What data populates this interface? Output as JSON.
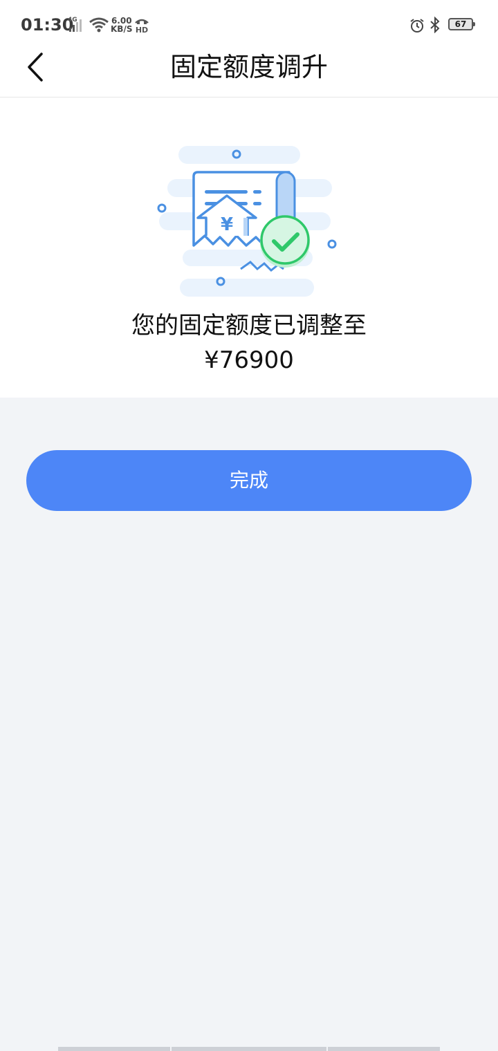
{
  "status_bar": {
    "time": "01:30",
    "network": "4G",
    "speed_value": "6.00",
    "speed_unit": "KB/S",
    "hd": "HD",
    "battery": "67"
  },
  "header": {
    "title": "固定额度调升"
  },
  "result": {
    "message": "您的固定额度已调整至",
    "amount": "¥76900"
  },
  "actions": {
    "done_label": "完成"
  },
  "colors": {
    "primary": "#4d86f7",
    "success": "#2fc86a",
    "background": "#f2f4f7"
  },
  "icons": {
    "back": "chevron-left-icon",
    "illustration": "receipt-approved-icon"
  }
}
